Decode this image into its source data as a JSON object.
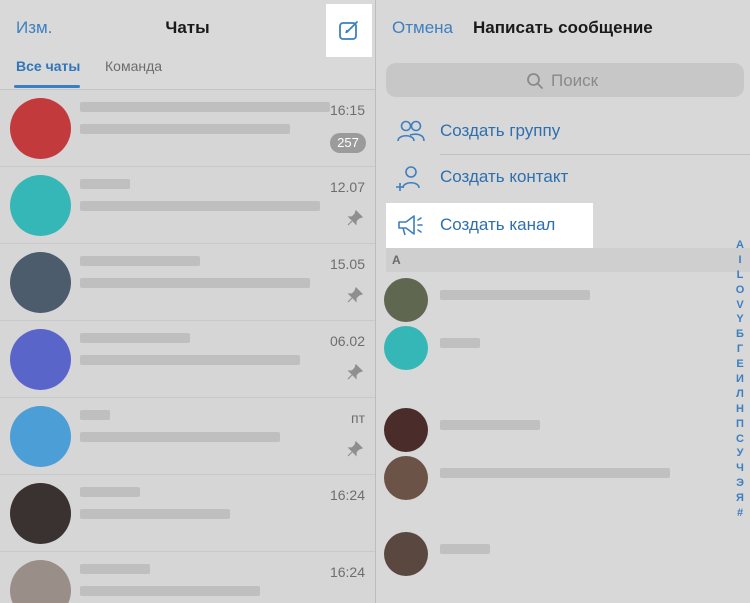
{
  "left": {
    "edit_label": "Изм.",
    "title": "Чаты",
    "tabs": [
      {
        "label": "Все чаты"
      },
      {
        "label": "Команда"
      }
    ],
    "chats": [
      {
        "time": "16:15",
        "badge": "257",
        "avatar_color": "#c23a3c",
        "pinned": false
      },
      {
        "time": "12.07",
        "avatar_color": "#36b7b7",
        "pinned": true
      },
      {
        "time": "15.05",
        "avatar_color": "#4c5c6d",
        "pinned": true
      },
      {
        "time": "06.02",
        "avatar_color": "#5a65c9",
        "pinned": true
      },
      {
        "time": "пт",
        "avatar_color": "#4b9ed6",
        "pinned": true
      },
      {
        "time": "16:24",
        "avatar_color": "#3a3230",
        "pinned": false
      },
      {
        "time": "16:24",
        "avatar_color": "#9a8f88",
        "pinned": false
      }
    ]
  },
  "right": {
    "cancel_label": "Отмена",
    "title": "Написать сообщение",
    "search_placeholder": "Поиск",
    "actions": [
      {
        "label": "Создать группу",
        "icon": "group-icon"
      },
      {
        "label": "Создать контакт",
        "icon": "add-contact-icon"
      },
      {
        "label": "Создать канал",
        "icon": "megaphone-icon"
      }
    ],
    "section_letter": "А",
    "contacts": [
      {
        "avatar_color": "#5f6750"
      },
      {
        "avatar_color": "#36b7b7"
      },
      {
        "avatar_color": "#4a2d2a"
      },
      {
        "avatar_color": "#6b5348"
      },
      {
        "avatar_color": "#5a4840"
      }
    ],
    "alphabet": [
      "А",
      "I",
      "L",
      "O",
      "V",
      "Y",
      "Б",
      "Г",
      "Е",
      "И",
      "Л",
      "Н",
      "П",
      "С",
      "У",
      "Ч",
      "Э",
      "Я",
      "#"
    ]
  },
  "colors": {
    "accent": "#3d7fbf",
    "highlight": "#ffffff"
  }
}
